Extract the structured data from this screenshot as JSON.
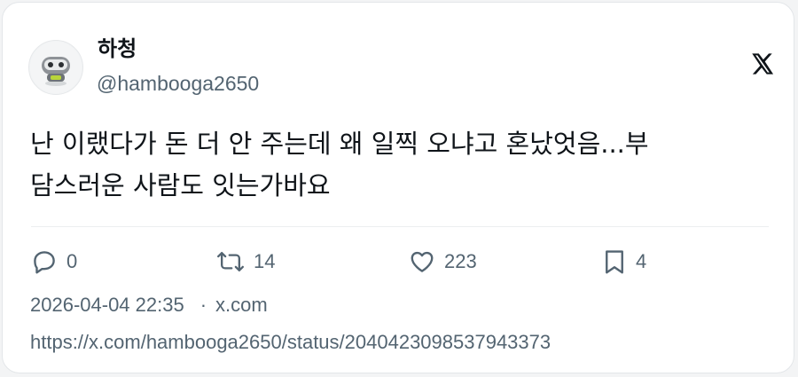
{
  "author": {
    "name": "하청",
    "handle": "@hambooga2650",
    "avatar_icon": "robot-avatar-icon"
  },
  "brand": {
    "icon": "x-logo-icon",
    "color": "#0f1419"
  },
  "tweet": {
    "text_line1": "난 이랬다가 돈 더 안 주는데 왜 일찍 오냐고 혼났엇음...부",
    "text_line2": "담스러운 사람도 잇는가바요"
  },
  "actions": {
    "reply": {
      "icon": "reply-icon",
      "count": "0"
    },
    "retweet": {
      "icon": "retweet-icon",
      "count": "14"
    },
    "like": {
      "icon": "heart-icon",
      "count": "223"
    },
    "bookmark": {
      "icon": "bookmark-icon",
      "count": "4"
    }
  },
  "meta": {
    "timestamp": "2026-04-04 22:35",
    "separator": "·",
    "source": "x.com"
  },
  "url": "https://x.com/hambooga2650/status/2040423098537943373",
  "colors": {
    "text": "#0f1419",
    "secondary": "#536471",
    "border": "#e3e6e9"
  }
}
